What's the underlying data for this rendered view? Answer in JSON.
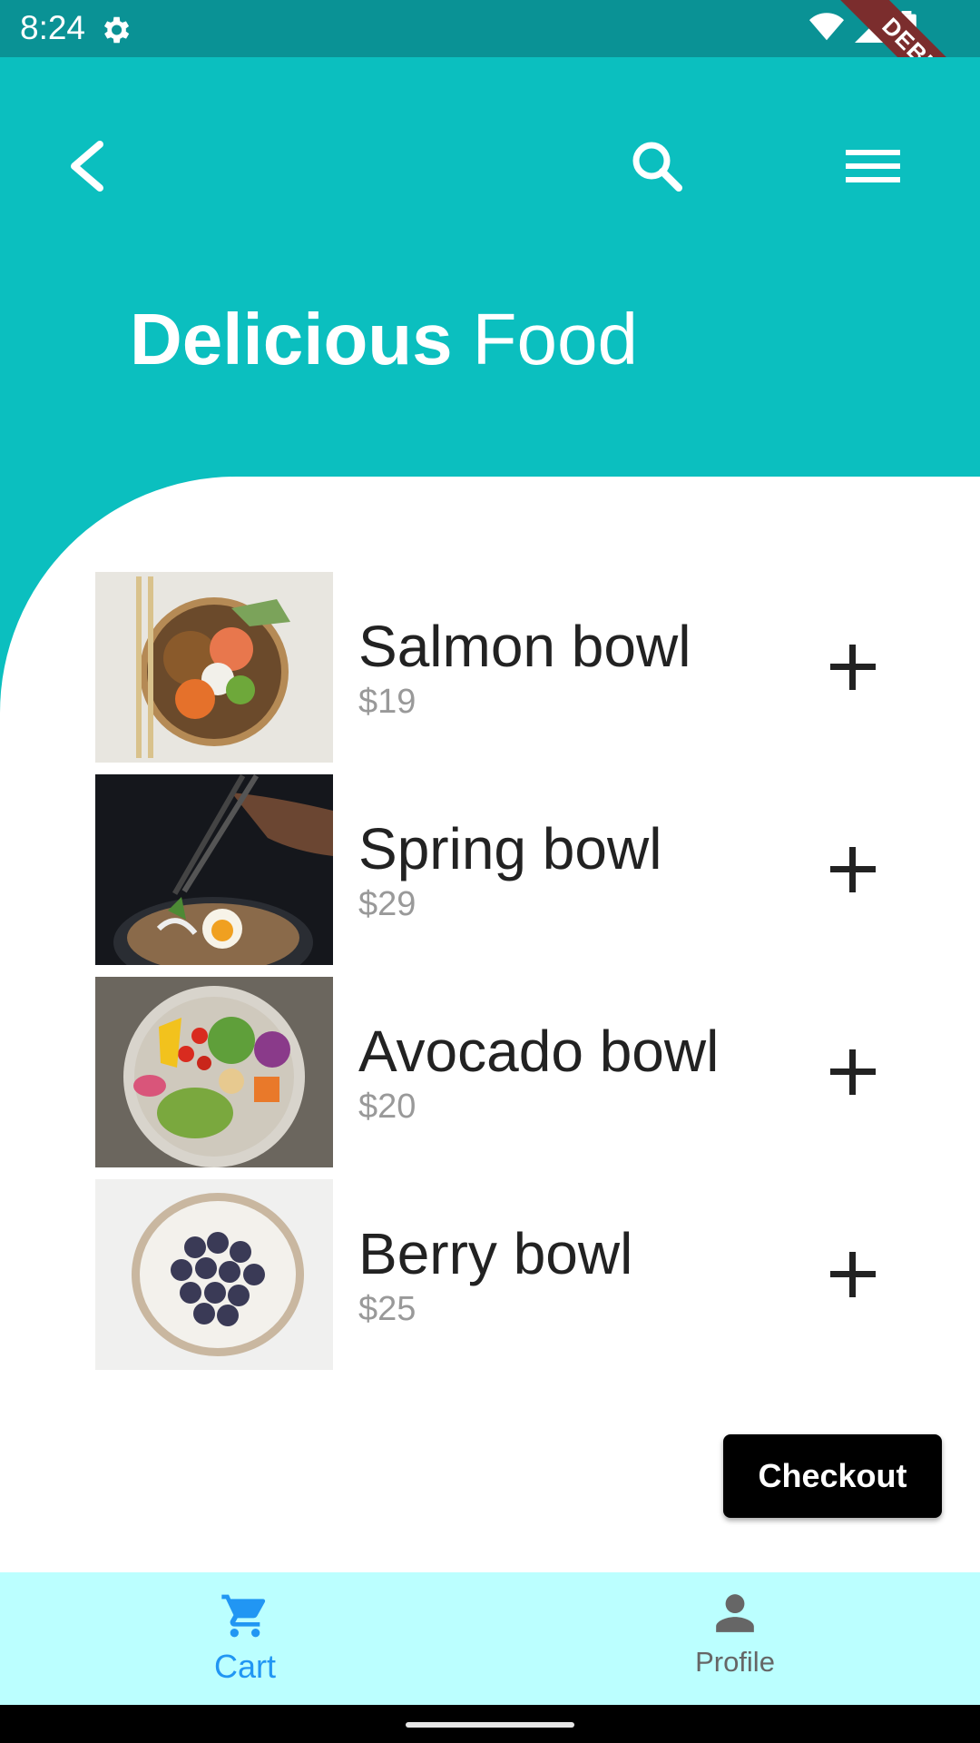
{
  "status": {
    "time": "8:24",
    "debug": "DEBUG"
  },
  "header": {
    "title_bold": "Delicious",
    "title_light": "Food"
  },
  "items": [
    {
      "name": "Salmon bowl",
      "price": "$19",
      "image": "salmon-bowl-image"
    },
    {
      "name": "Spring bowl",
      "price": "$29",
      "image": "spring-bowl-image"
    },
    {
      "name": "Avocado bowl",
      "price": "$20",
      "image": "avocado-bowl-image"
    },
    {
      "name": "Berry bowl",
      "price": "$25",
      "image": "berry-bowl-image"
    }
  ],
  "checkout": {
    "label": "Checkout"
  },
  "nav": {
    "cart": "Cart",
    "profile": "Profile"
  },
  "colors": {
    "primary": "#0bbfbf",
    "statusbar": "#0a9295",
    "nav_bg": "#bbffff",
    "active": "#2196f3"
  }
}
